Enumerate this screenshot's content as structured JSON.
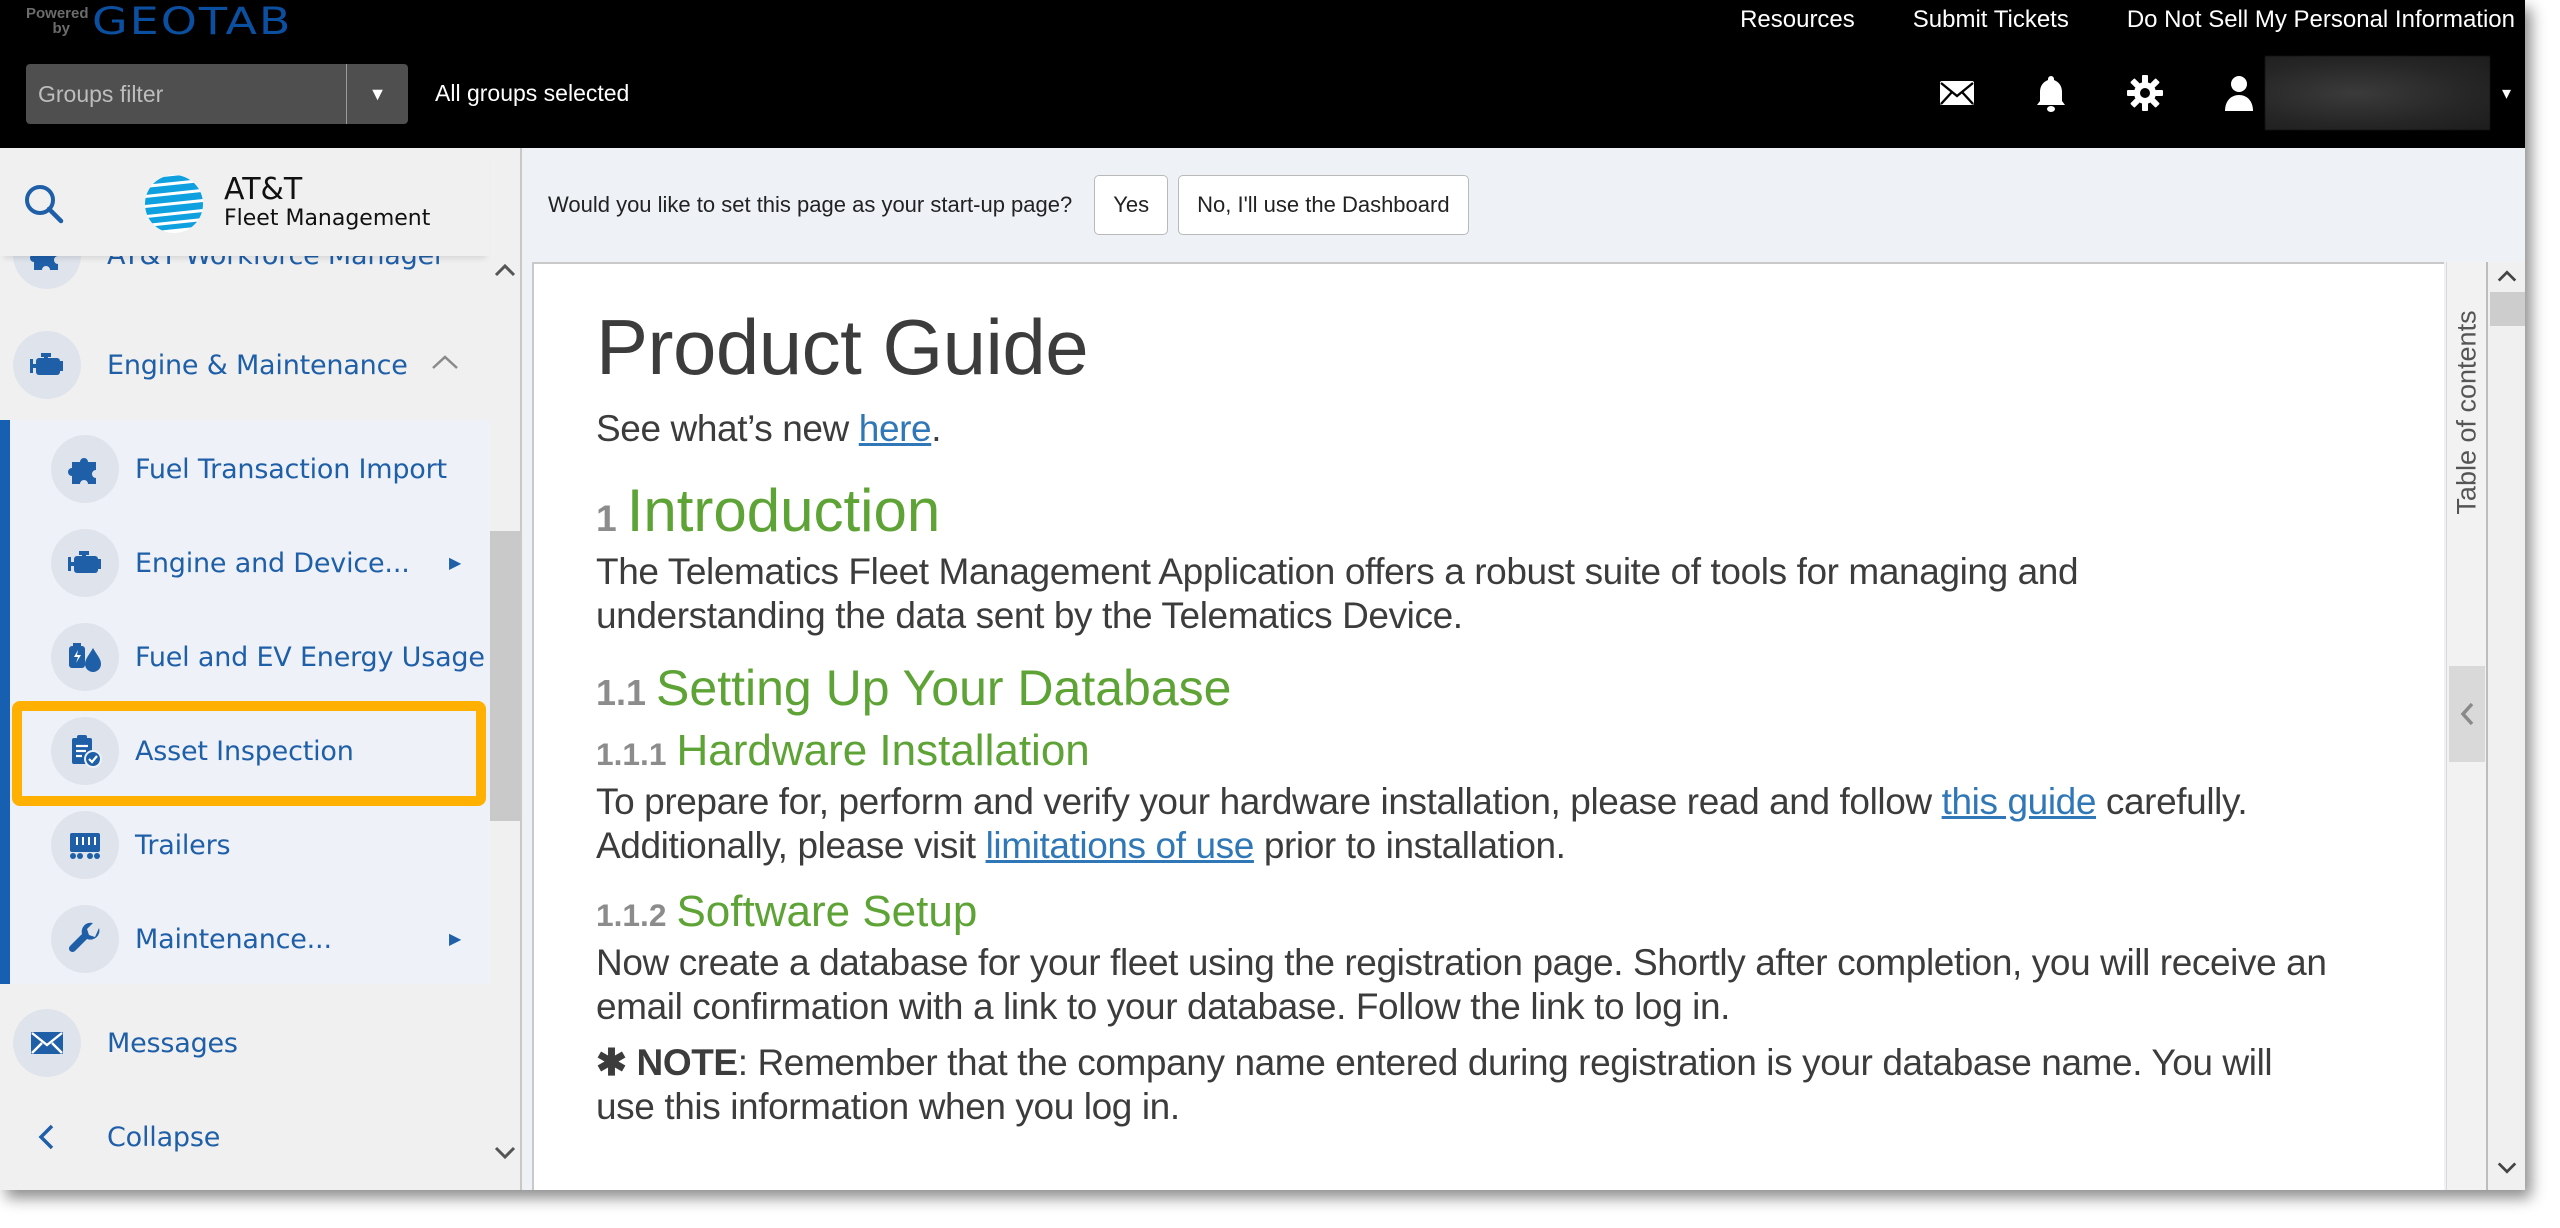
{
  "header": {
    "brand_powered": "Powered by",
    "brand_name": "GEOTAB",
    "links": [
      "Resources",
      "Submit Tickets",
      "Do Not Sell My Personal Information"
    ],
    "groups_filter_placeholder": "Groups filter",
    "groups_status": "All groups selected",
    "icons": [
      "mail-icon",
      "bell-icon",
      "gear-icon",
      "user-icon"
    ],
    "user_caret": "▾"
  },
  "sidebar": {
    "logo_title": "AT&T",
    "logo_subtitle": "Fleet Management",
    "items": [
      {
        "label": "AT&T Workforce Manager",
        "icon": "puzzle-icon",
        "level": "top"
      },
      {
        "label": "Engine & Maintenance",
        "icon": "engine-icon",
        "level": "top",
        "expanded": true
      },
      {
        "label": "Fuel Transaction Import",
        "icon": "puzzle-icon",
        "level": "sub"
      },
      {
        "label": "Engine and Device...",
        "icon": "engine-icon",
        "level": "sub",
        "has_submenu": true
      },
      {
        "label": "Fuel and EV Energy Usage",
        "icon": "fuel-ev-icon",
        "level": "sub"
      },
      {
        "label": "Asset Inspection",
        "icon": "inspection-icon",
        "level": "sub",
        "highlighted": true
      },
      {
        "label": "Trailers",
        "icon": "trailer-icon",
        "level": "sub"
      },
      {
        "label": "Maintenance...",
        "icon": "wrench-icon",
        "level": "sub",
        "has_submenu": true
      },
      {
        "label": "Messages",
        "icon": "mail-icon",
        "level": "top"
      },
      {
        "label": "Collapse",
        "icon": "chevron-left-icon",
        "level": "top"
      }
    ]
  },
  "prompt": {
    "question": "Would you like to set this page as your start-up page?",
    "yes_label": "Yes",
    "no_label": "No, I'll use the Dashboard"
  },
  "doc": {
    "title": "Product Guide",
    "whats_new_prefix": "See what’s new ",
    "whats_new_link": "here",
    "whats_new_suffix": ".",
    "sec1_num": "1",
    "sec1_title": "Introduction",
    "sec1_body": "The Telematics Fleet Management Application offers a robust suite of tools for managing and understanding the data sent by the Telematics Device.",
    "sec11_num": "1.1",
    "sec11_title": "Setting Up Your Database",
    "sec111_num": "1.1.1",
    "sec111_title": "Hardware Installation",
    "sec111_p1_a": "To prepare for, perform and verify your hardware installation, please read and follow ",
    "sec111_p1_link": "this guide",
    "sec111_p1_b": " carefully.",
    "sec111_p2_a": "Additionally, please visit ",
    "sec111_p2_link": "limitations of use",
    "sec111_p2_b": " prior to installation.",
    "sec112_num": "1.1.2",
    "sec112_title": "Software Setup",
    "sec112_body": "Now create a database for your fleet using the registration page. Shortly after completion, you will receive an email confirmation with a link to your database. Follow the link to log in.",
    "note_star": "✱",
    "note_label": "NOTE",
    "note_body": ": Remember that the company name entered during registration is your database name. You will use this information when you log in."
  },
  "toc": {
    "label": "Table of contents"
  },
  "colors": {
    "topbar": "#000000",
    "brand_blue": "#0b4fa0",
    "nav_blue": "#1f5fa8",
    "heading_green": "#5ea335",
    "link_blue": "#2f77b6",
    "highlight": "#ffb000"
  }
}
